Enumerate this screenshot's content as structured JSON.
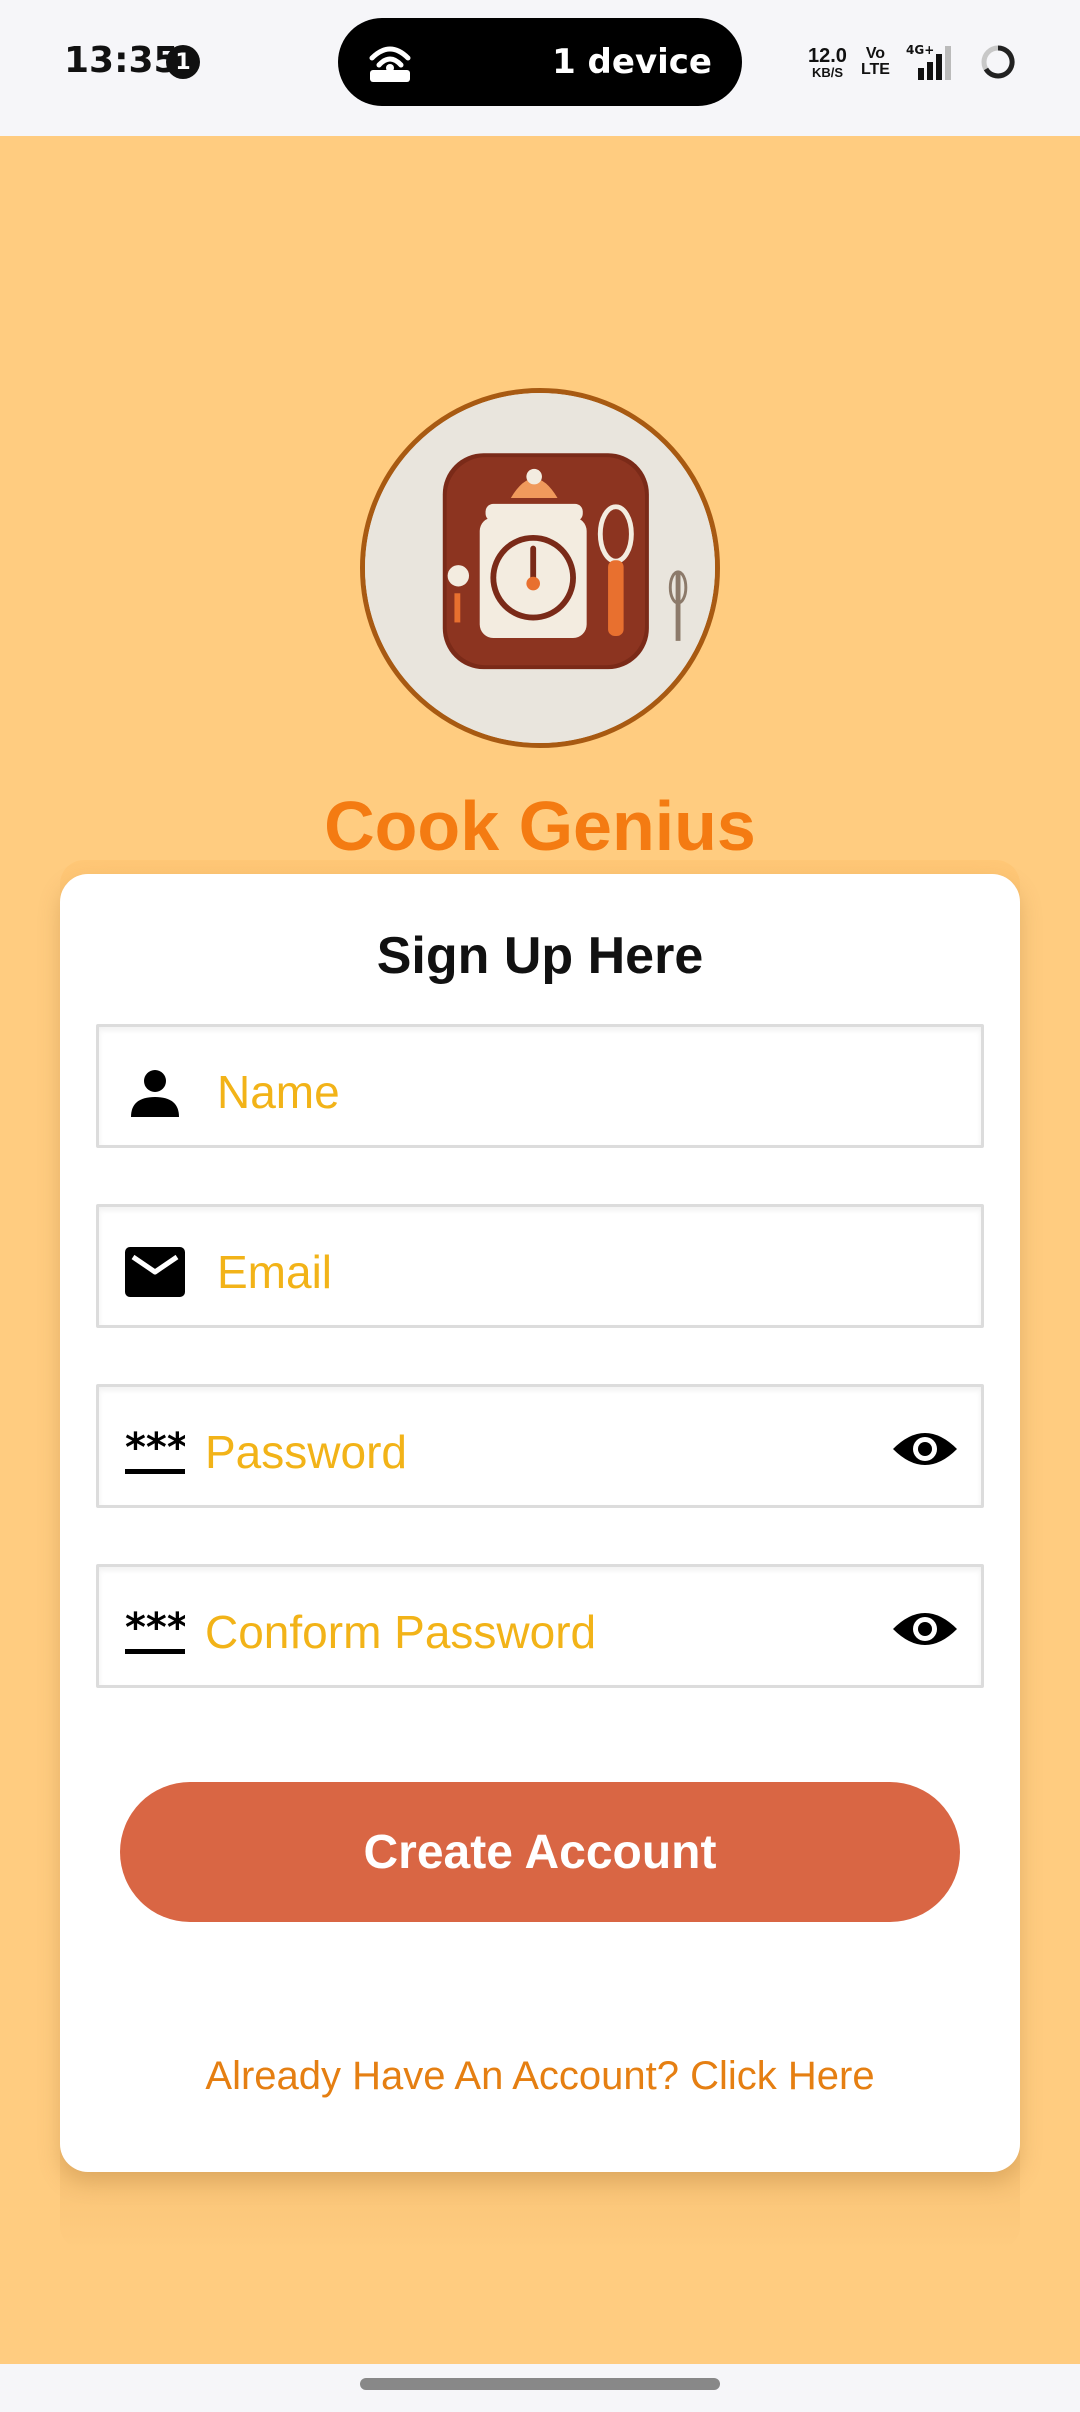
{
  "status_bar": {
    "time": "13:35",
    "notification_count": "1",
    "hotspot_text": "1 device",
    "net_speed_value": "12.0",
    "net_speed_unit": "KB/S",
    "volte_top": "Vo",
    "volte_bottom": "LTE",
    "network_type": "4G+"
  },
  "app": {
    "name": "Cook Genius",
    "logo_icon": "kitchen-timer-logo"
  },
  "form": {
    "title": "Sign Up Here",
    "name_placeholder": "Name",
    "email_placeholder": "Email",
    "password_placeholder": "Password",
    "confirm_placeholder": "Conform Password",
    "create_label": "Create Account",
    "login_link": "Already Have An Account? Click Here"
  },
  "colors": {
    "background": "#ffcc80",
    "brand": "#f47b12",
    "button": "#d96644",
    "placeholder": "#f2b318",
    "link": "#e57f12"
  }
}
